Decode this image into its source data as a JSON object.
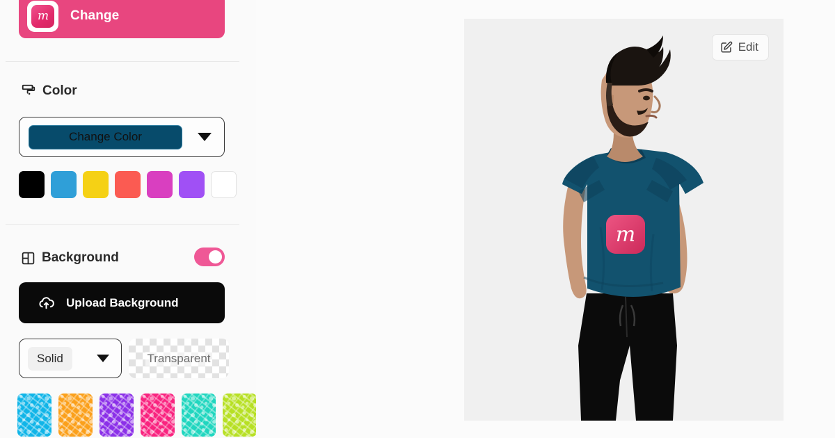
{
  "sidebar": {
    "change_button": {
      "label": "Change",
      "logo_glyph": "m",
      "icon": "app-logo-icon",
      "bg": "#e8467f"
    },
    "color_section": {
      "title": "Color",
      "icon": "paint-roller-icon",
      "select": {
        "value": "Change Color",
        "swatch_color": "#074b6b",
        "caret": "chevron-down-icon"
      },
      "swatches": [
        {
          "name": "black",
          "hex": "#000000"
        },
        {
          "name": "blue",
          "hex": "#2f9fd8"
        },
        {
          "name": "yellow",
          "hex": "#f5d115"
        },
        {
          "name": "red",
          "hex": "#fb5b52"
        },
        {
          "name": "magenta",
          "hex": "#d93fc0"
        },
        {
          "name": "purple",
          "hex": "#a050f5"
        },
        {
          "name": "white",
          "hex": "#ffffff"
        }
      ]
    },
    "background_section": {
      "title": "Background",
      "icon": "layout-frame-icon",
      "toggle": {
        "name": "background-toggle",
        "state": "on",
        "color": "#ef5896"
      },
      "upload_button": {
        "label": "Upload Background",
        "icon": "cloud-upload-icon"
      },
      "fill_select": {
        "value": "Solid",
        "caret": "chevron-down-icon"
      },
      "transparent_button": {
        "label": "Transparent"
      },
      "patterns": [
        {
          "name": "pattern-cyan",
          "hex": "#10b5e8"
        },
        {
          "name": "pattern-orange",
          "hex": "#fba01b"
        },
        {
          "name": "pattern-purple",
          "hex": "#8b30e8"
        },
        {
          "name": "pattern-pink",
          "hex": "#f9237f"
        },
        {
          "name": "pattern-teal",
          "hex": "#20d6bf"
        },
        {
          "name": "pattern-lime",
          "hex": "#b7e024"
        }
      ]
    },
    "scrollbar": {
      "name": "sidebar-scrollbar",
      "thumb_color": "#c3c3c3"
    }
  },
  "canvas": {
    "edit_button": {
      "label": "Edit",
      "icon": "edit-pencil-icon"
    },
    "preview": {
      "name": "tshirt-mockup-preview",
      "background": "#f0f0f0",
      "shirt_color": "#12526e",
      "pants_color": "#0b0b0b",
      "logo": {
        "name": "chest-logo",
        "glyph": "m",
        "color": "#e03a72"
      }
    }
  }
}
